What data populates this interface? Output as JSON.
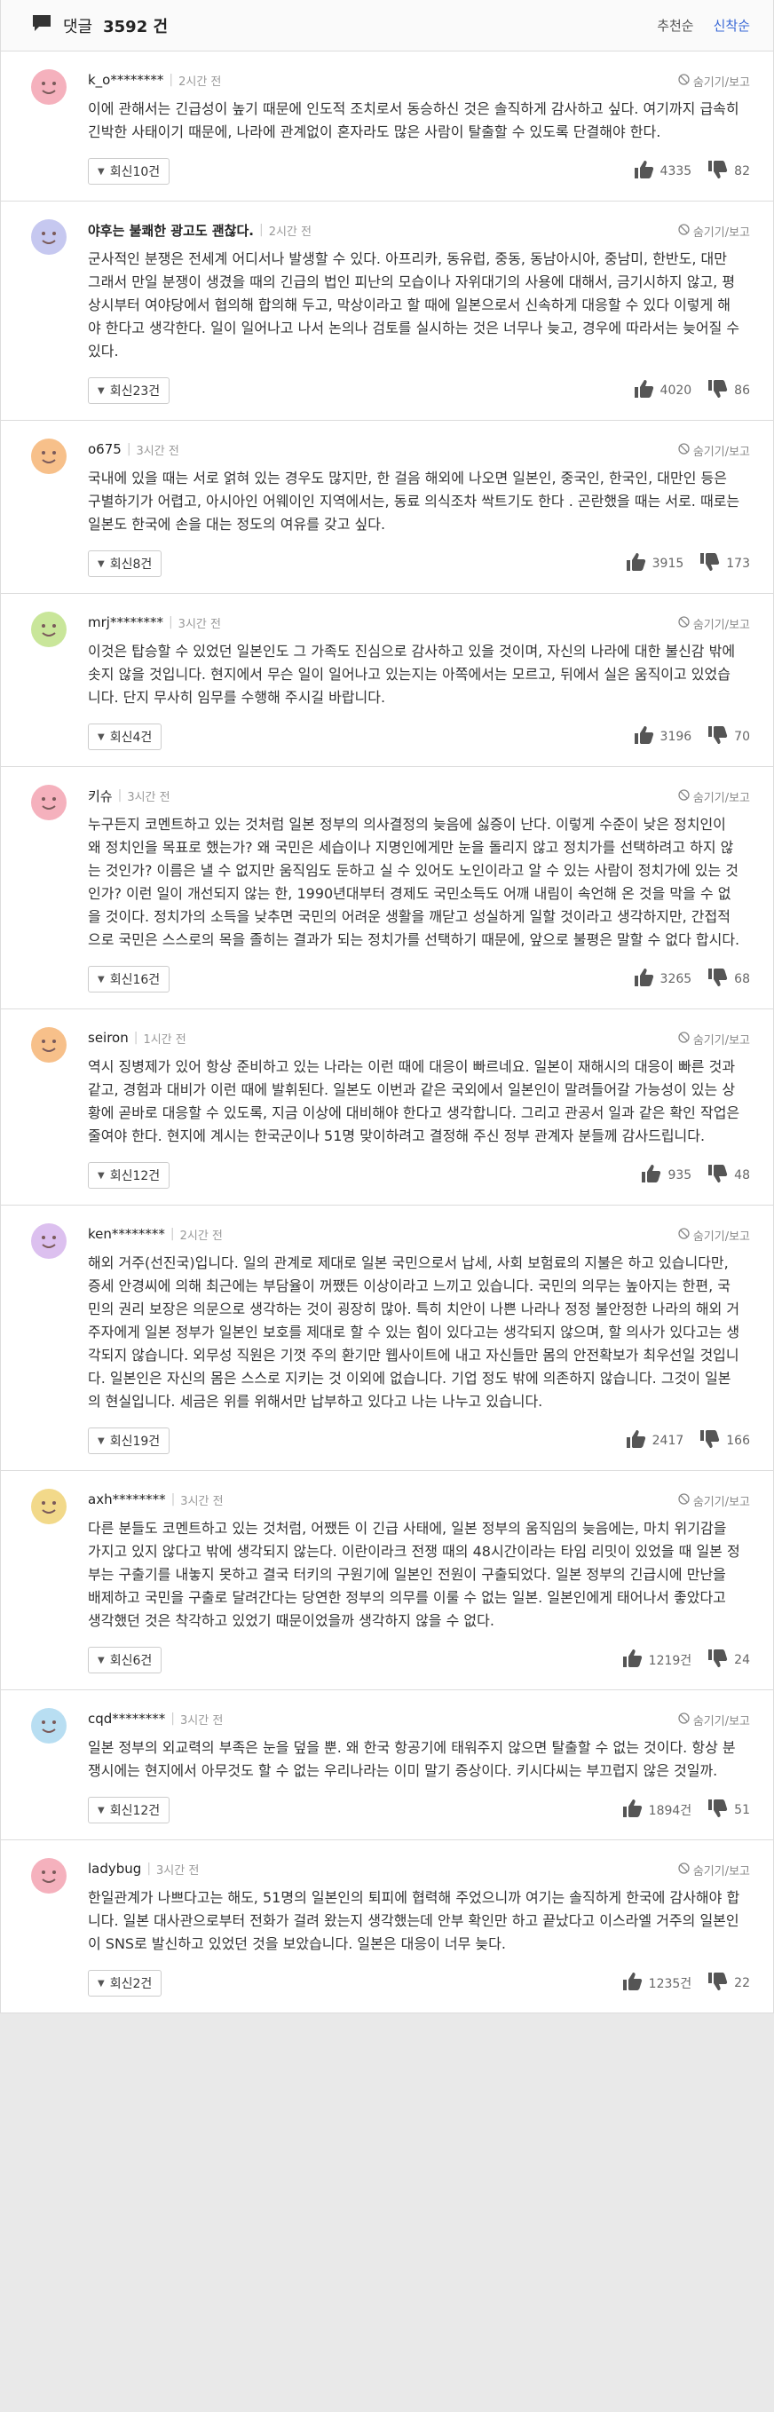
{
  "header": {
    "title": "댓글",
    "count": "3592 건",
    "sort_recommend": "추천순",
    "sort_latest": "신착순"
  },
  "hide_label": "숨기기/보고",
  "colors": {
    "accent": "#3b69d6"
  },
  "comments": [
    {
      "user": "k_o********",
      "time": "2시간 전",
      "bold": false,
      "avatar_color": "#f5b1bd",
      "text": "이에 관해서는 긴급성이 높기 때문에 인도적 조치로서 동승하신 것은 솔직하게 감사하고 싶다. 여기까지 급속히 긴박한 사태이기 때문에, 나라에 관계없이 혼자라도 많은 사람이 탈출할 수 있도록 단결해야 한다.",
      "reply_label": "회신10건",
      "up": "4335",
      "down": "82"
    },
    {
      "user": "야후는 불쾌한 광고도 괜찮다.",
      "time": "2시간 전",
      "bold": true,
      "avatar_color": "#c6c8f0",
      "text": "군사적인 분쟁은 전세계 어디서나 발생할 수 있다. 아프리카, 동유럽, 중동, 동남아시아, 중남미, 한반도, 대만 그래서 만일 분쟁이 생겼을 때의 긴급의 법인 피난의 모습이나 자위대기의 사용에 대해서, 금기시하지 않고, 평상시부터 여야당에서 협의해 합의해 두고, 막상이라고 할 때에 일본으로서 신속하게 대응할 수 있다 이렇게 해야 한다고 생각한다. 일이 일어나고 나서 논의나 검토를 실시하는 것은 너무나 늦고, 경우에 따라서는 늦어질 수 있다.",
      "reply_label": "회신23건",
      "up": "4020",
      "down": "86"
    },
    {
      "user": "o675",
      "time": "3시간 전",
      "bold": false,
      "avatar_color": "#f7c08a",
      "text": "국내에 있을 때는 서로 얽혀 있는 경우도 많지만, 한 걸음 해외에 나오면 일본인, 중국인, 한국인, 대만인 등은 구별하기가 어렵고, 아시아인 어웨이인 지역에서는, 동료 의식조차 싹트기도 한다 . 곤란했을 때는 서로. 때로는 일본도 한국에 손을 대는 정도의 여유를 갖고 싶다.",
      "reply_label": "회신8건",
      "up": "3915",
      "down": "173"
    },
    {
      "user": "mrj********",
      "time": "3시간 전",
      "bold": false,
      "avatar_color": "#c9e69a",
      "text": "이것은 탑승할 수 있었던 일본인도 그 가족도 진심으로 감사하고 있을 것이며, 자신의 나라에 대한 불신감 밖에 솟지 않을 것입니다. 현지에서 무슨 일이 일어나고 있는지는 아쪽에서는 모르고, 뒤에서 실은 움직이고 있었습니다. 단지 무사히 임무를 수행해 주시길 바랍니다.",
      "reply_label": "회신4건",
      "up": "3196",
      "down": "70"
    },
    {
      "user": "키슈",
      "time": "3시간 전",
      "bold": false,
      "avatar_color": "#f5b1bd",
      "text": "누구든지 코멘트하고 있는 것처럼 일본 정부의 의사결정의 늦음에 싫증이 난다. 이렇게 수준이 낮은 정치인이 왜 정치인을 목표로 했는가? 왜 국민은 세습이나 지명인에게만 눈을 돌리지 않고 정치가를 선택하려고 하지 않는 것인가? 이름은 낼 수 없지만 움직임도 둔하고 실 수 있어도 노인이라고 알 수 있는 사람이 정치가에 있는 것인가? 이런 일이 개선되지 않는 한, 1990년대부터 경제도 국민소득도 어깨 내림이 속언해 온 것을 막을 수 없을 것이다. 정치가의 소득을 낮추면 국민의 어려운 생활을 깨닫고 성실하게 일할 것이라고 생각하지만, 간접적으로 국민은 스스로의 목을 졸히는 결과가 되는 정치가를 선택하기 때문에, 앞으로 불평은 말할 수 없다 합시다.",
      "reply_label": "회신16건",
      "up": "3265",
      "down": "68"
    },
    {
      "user": "seiron",
      "time": "1시간 전",
      "bold": false,
      "avatar_color": "#f7c08a",
      "text": "역시 징병제가 있어 항상 준비하고 있는 나라는 이런 때에 대응이 빠르네요. 일본이 재해시의 대응이 빠른 것과 같고, 경험과 대비가 이런 때에 발휘된다. 일본도 이번과 같은 국외에서 일본인이 말려들어갈 가능성이 있는 상황에 곧바로 대응할 수 있도록, 지금 이상에 대비해야 한다고 생각합니다. 그리고 관공서 일과 같은 확인 작업은 줄여야 한다. 현지에 계시는 한국군이나 51명 맞이하려고 결정해 주신 정부 관계자 분들께 감사드립니다.",
      "reply_label": "회신12건",
      "up": "935",
      "down": "48"
    },
    {
      "user": "ken********",
      "time": "2시간 전",
      "bold": false,
      "avatar_color": "#dcc0ef",
      "text": "해외 거주(선진국)입니다. 일의 관계로 제대로 일본 국민으로서 납세, 사회 보험료의 지불은 하고 있습니다만, 증세 안경씨에 의해 최근에는 부담율이 꺼쨌든 이상이라고 느끼고 있습니다. 국민의 의무는 높아지는 한편, 국민의 권리 보장은 의문으로 생각하는 것이 굉장히 많아. 특히 치안이 나쁜 나라나 정정 불안정한 나라의 해외 거주자에게 일본 정부가 일본인 보호를 제대로 할 수 있는 힘이 있다고는 생각되지 않으며, 할 의사가 있다고는 생각되지 않습니다. 외무성 직원은 기껏 주의 환기만 웹사이트에 내고 자신들만 몸의 안전확보가 최우선일 것입니다. 일본인은 자신의 몸은 스스로 지키는 것 이외에 없습니다. 기업 정도 밖에 의존하지 않습니다. 그것이 일본의 현실입니다. 세금은 위를 위해서만 납부하고 있다고 나는 나누고 있습니다.",
      "reply_label": "회신19건",
      "up": "2417",
      "down": "166"
    },
    {
      "user": "axh********",
      "time": "3시간 전",
      "bold": false,
      "avatar_color": "#f2d98a",
      "text": "다른 분들도 코멘트하고 있는 것처럼, 어쨌든 이 긴급 사태에, 일본 정부의 움직임의 늦음에는, 마치 위기감을 가지고 있지 않다고 밖에 생각되지 않는다. 이란이라크 전쟁 때의 48시간이라는 타임 리밋이 있었을 때 일본 정부는 구출기를 내놓지 못하고 결국 터키의 구원기에 일본인 전원이 구출되었다. 일본 정부의 긴급시에 만난을 배제하고 국민을 구출로 달려간다는 당연한 정부의 의무를 이룰 수 없는 일본. 일본인에게 태어나서 좋았다고 생각했던 것은 착각하고 있었기 때문이었을까 생각하지 않을 수 없다.",
      "reply_label": "회신6건",
      "up": "1219건",
      "down": "24"
    },
    {
      "user": "cqd********",
      "time": "3시간 전",
      "bold": false,
      "avatar_color": "#b8def2",
      "text": "일본 정부의 외교력의 부족은 눈을 덮을 뿐. 왜 한국 항공기에 태워주지 않으면 탈출할 수 없는 것이다. 항상 분쟁시에는 현지에서 아무것도 할 수 없는 우리나라는 이미 말기 증상이다. 키시다씨는 부끄럽지 않은 것일까.",
      "reply_label": "회신12건",
      "up": "1894건",
      "down": "51"
    },
    {
      "user": "ladybug",
      "time": "3시간 전",
      "bold": false,
      "avatar_color": "#f5b1bd",
      "text": "한일관계가 나쁘다고는 해도, 51명의 일본인의 퇴피에 협력해 주었으니까 여기는 솔직하게 한국에 감사해야 합니다. 일본 대사관으로부터 전화가 걸려 왔는지 생각했는데 안부 확인만 하고 끝났다고 이스라엘 거주의 일본인이 SNS로 발신하고 있었던 것을 보았습니다. 일본은 대응이 너무 늦다.",
      "reply_label": "회신2건",
      "up": "1235건",
      "down": "22"
    }
  ]
}
